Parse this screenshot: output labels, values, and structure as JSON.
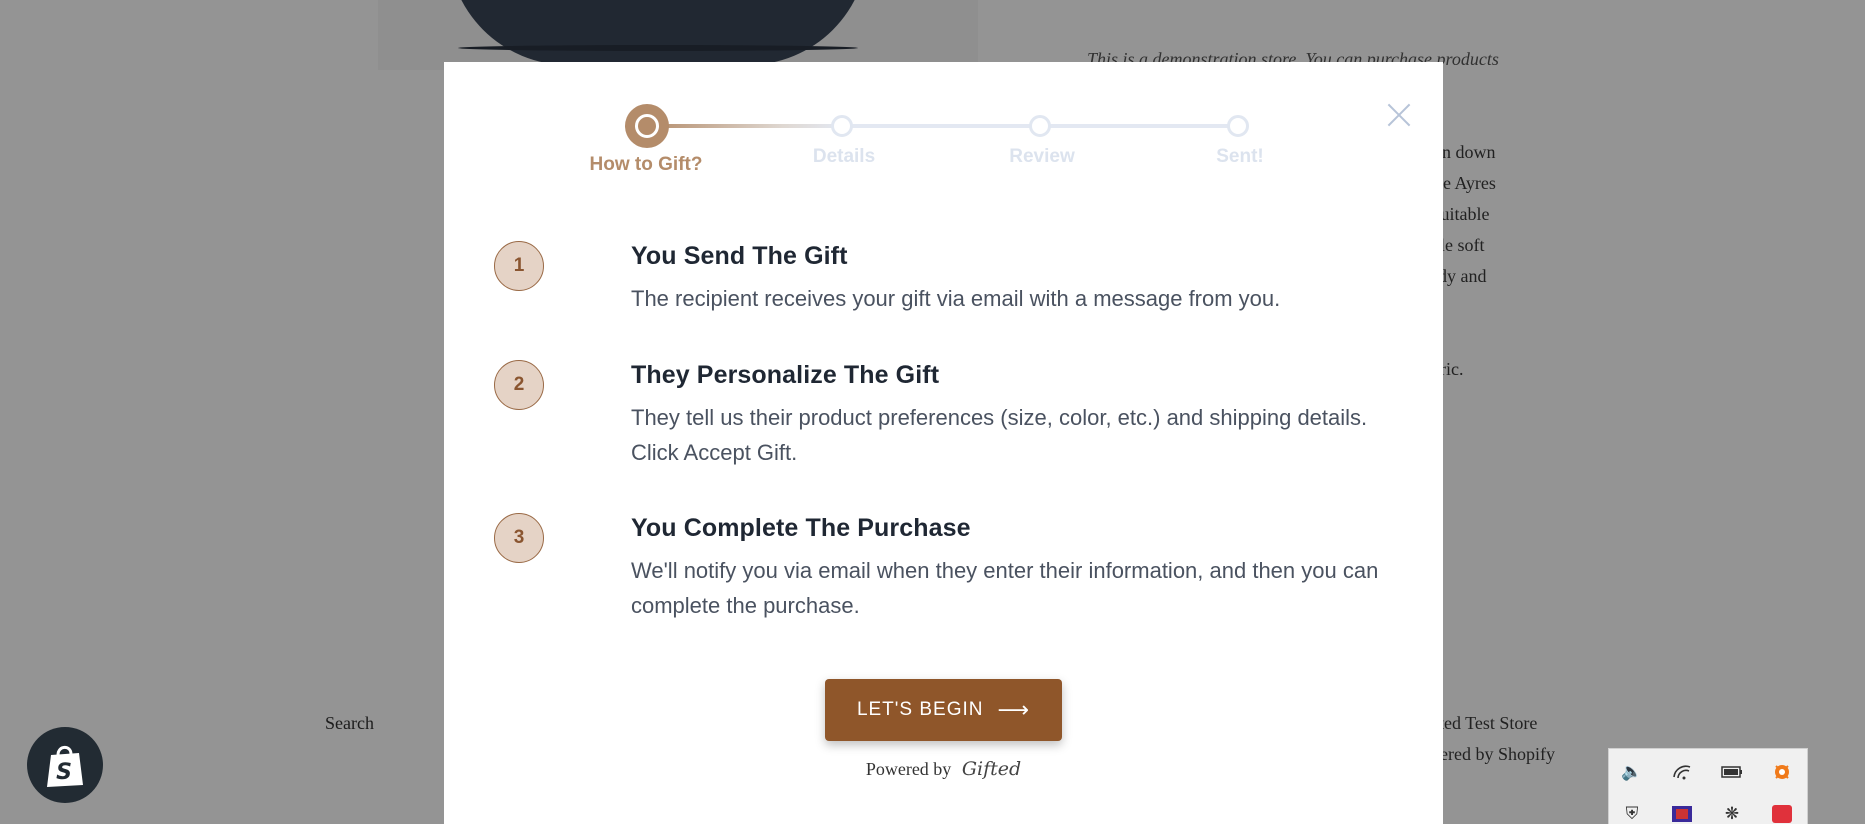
{
  "background": {
    "demo_text": "This is a demonstration store. You can purchase products",
    "description_lines": [
      "tton down",
      "The Ayres",
      "r suitable",
      "able soft",
      "urdy and",
      "abric."
    ],
    "search_link": "Search",
    "footer_store": "ifted Test Store",
    "footer_powered": "ered by Shopify"
  },
  "modal": {
    "steps": [
      {
        "label": "How to Gift?",
        "active": true
      },
      {
        "label": "Details",
        "active": false
      },
      {
        "label": "Review",
        "active": false
      },
      {
        "label": "Sent!",
        "active": false
      }
    ],
    "items": [
      {
        "number": "1",
        "title": "You Send The Gift",
        "body": "The recipient receives your gift via email with a message from you."
      },
      {
        "number": "2",
        "title": "They Personalize The Gift",
        "body": "They tell us their product preferences (size, color, etc.) and shipping details. Click Accept Gift."
      },
      {
        "number": "3",
        "title": "You Complete The Purchase",
        "body": "We'll notify you via email when they enter their information, and then you can complete the purchase."
      }
    ],
    "cta_label": "LET'S BEGIN",
    "powered_by": "Powered by",
    "powered_logo": "Gifted"
  },
  "colors": {
    "accent": "#8f562a",
    "step_active": "#b48c6a",
    "step_inactive": "#dce3ee"
  }
}
